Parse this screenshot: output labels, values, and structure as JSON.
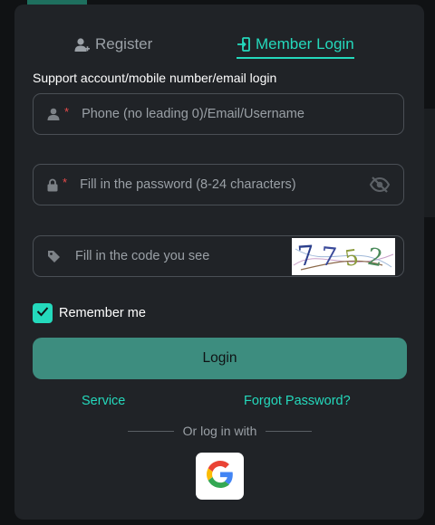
{
  "tabs": {
    "register_label": "Register",
    "login_label": "Member Login",
    "active": "Member Login"
  },
  "form": {
    "subtitle": "Support account/mobile number/email login",
    "account_placeholder": "Phone (no leading 0)/Email/Username",
    "account_required_mark": "*",
    "password_placeholder": "Fill in the password (8-24 characters)",
    "password_required_mark": "*",
    "code_placeholder": "Fill in the code you see",
    "captcha_text": "7752"
  },
  "remember": {
    "label": "Remember me",
    "checked": true
  },
  "login_button": "Login",
  "links": {
    "service": "Service",
    "forgot": "Forgot Password?"
  },
  "alt_login": {
    "divider_text": "Or log in with",
    "providers": [
      "google"
    ]
  },
  "colors": {
    "accent": "#24d9bc",
    "button_bg": "#3d8d7f",
    "panel_bg": "#202327",
    "required": "#e84b4b"
  },
  "icons": [
    "user-plus-icon",
    "login-door-icon",
    "user-icon",
    "lock-icon",
    "eye-off-icon",
    "tag-icon",
    "check-icon",
    "google-icon"
  ]
}
